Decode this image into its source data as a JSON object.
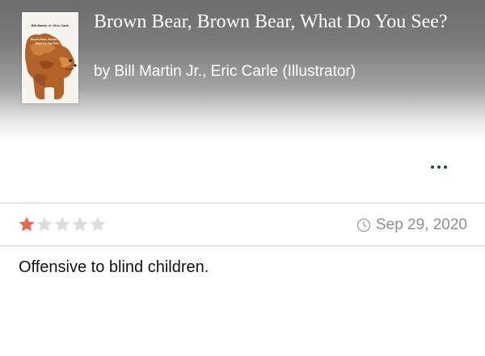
{
  "book": {
    "title": "Brown Bear, Brown Bear, What Do You See?",
    "authors": "by Bill Martin Jr., Eric Carle (Illustrator)",
    "cover": {
      "author_text": "Bill Martin Jr / Eric Carle",
      "title_text": "Brown Bear, Brown Bear, What Do You See?"
    }
  },
  "review": {
    "rating": 1,
    "rating_max": 5,
    "date": "Sep 29, 2020",
    "text": "Offensive to blind children."
  },
  "colors": {
    "star_filled": "#e8684f",
    "star_empty": "#dddddd",
    "more_dots": "#1d4a3a",
    "date_text": "#8e8e8e"
  },
  "icons": {
    "more": "more-dots-icon",
    "clock": "clock-icon",
    "star": "star-icon"
  }
}
